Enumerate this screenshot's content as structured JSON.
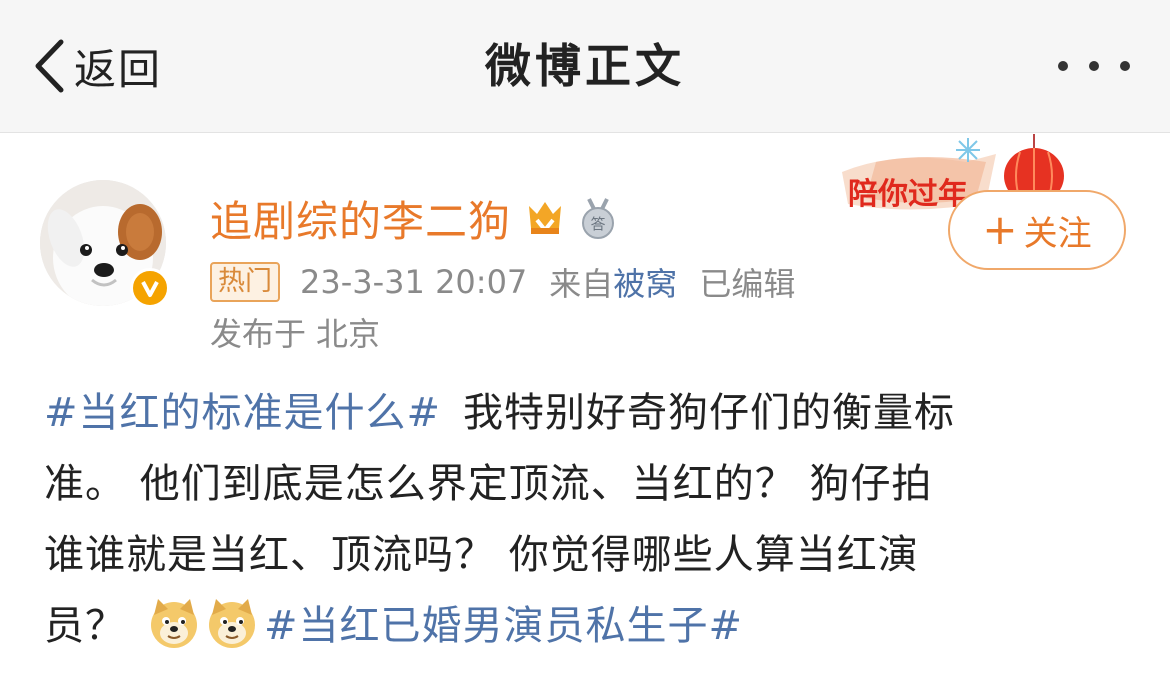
{
  "navbar": {
    "back_label": "返回",
    "title": "微博正文",
    "more_icon": "more-horizontal-icon"
  },
  "author": {
    "name": "追剧综的李二狗",
    "name_color": "#e8792a",
    "avatar_icon": "dog-avatar",
    "verified_icon": "verified-v-icon",
    "vip_icon": "vip-crown-icon",
    "medal_icon": "medal-icon",
    "medal_text": "答"
  },
  "promo": {
    "text": "陪你过年",
    "icon": "lantern-icon"
  },
  "follow_button": {
    "plus": "+",
    "label": "关注"
  },
  "meta": {
    "hot_tag": "热门",
    "time": "23-3-31 20:07",
    "source_label": "来自",
    "source": "被窝",
    "edited": "已编辑",
    "location_label": "发布于",
    "location": "北京"
  },
  "post": {
    "hashtag_1": "#当红的标准是什么#",
    "line1_text": "我特别好奇狗仔们的衡量标",
    "line2_text": "准。 他们到底是怎么界定顶流、当红的？ 狗仔拍",
    "line3_text": "谁谁就是当红、顶流吗？ 你觉得哪些人算当红演",
    "line4_text": "员？",
    "emoji": "doge-emoji",
    "hashtag_2": "#当红已婚男演员私生子#"
  },
  "colors": {
    "link": "#4f73a8",
    "accent": "#e8792a",
    "meta_gray": "#8a8a8a"
  }
}
